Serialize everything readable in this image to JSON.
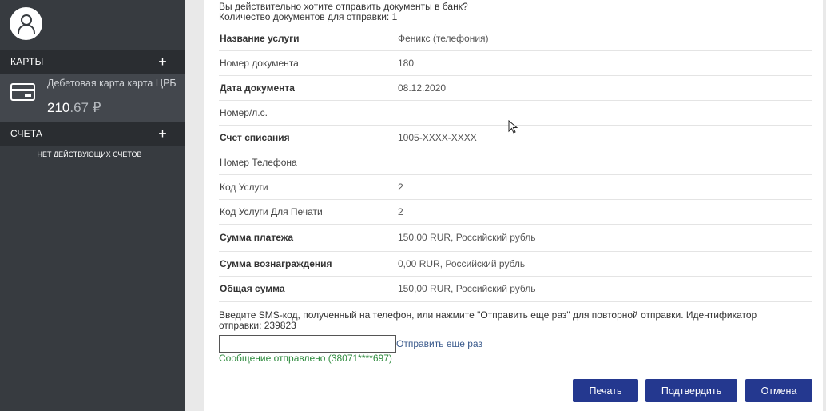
{
  "sidebar": {
    "cards_label": "КАРТЫ",
    "card_name": "Дебетовая карта карта ЦРБ",
    "card_balance_main": "210",
    "card_balance_cents": ".67",
    "card_currency": "₽",
    "accounts_label": "СЧЕТА",
    "no_accounts": "НЕТ ДЕЙСТВУЮЩИХ СЧЕТОВ",
    "plus_symbol": "+"
  },
  "form": {
    "question": "Вы действительно хотите отправить документы в банк?",
    "count_line": "Количество документов для отправки: 1",
    "rows": [
      {
        "label": "Название услуги",
        "value": "Феникс (телефония)",
        "bold": true
      },
      {
        "label": "Номер документа",
        "value": "180",
        "bold": false
      },
      {
        "label": "Дата документа",
        "value": "08.12.2020",
        "bold": true
      },
      {
        "label": "Номер/л.с.",
        "value": "",
        "bold": false
      },
      {
        "label": "Счет списания",
        "value": "1005-XXXX-XXXX",
        "bold": true
      },
      {
        "label": "Номер Телефона",
        "value": "",
        "bold": false
      },
      {
        "label": "Код Услуги",
        "value": "2",
        "bold": false
      },
      {
        "label": "Код Услуги Для Печати",
        "value": "2",
        "bold": false
      },
      {
        "label": "Сумма платежа",
        "value": "150,00 RUR, Российский рубль",
        "bold": true
      },
      {
        "label": "Сумма вознаграждения",
        "value": "0,00 RUR, Российский рубль",
        "bold": true
      },
      {
        "label": "Общая сумма",
        "value": "150,00 RUR, Российский рубль",
        "bold": true
      }
    ],
    "sms_instruction": "Введите SMS-код, полученный на телефон, или нажмите \"Отправить еще раз\" для повторной отправки. Идентификатор отправки: 239823",
    "sms_input_value": "",
    "resend_label": "Отправить еще раз",
    "sent_message": "Сообщение отправлено (38071****697)"
  },
  "buttons": {
    "print": "Печать",
    "confirm": "Подтвердить",
    "cancel": "Отмена"
  },
  "colors": {
    "sidebar_bg": "#373b40",
    "button_bg": "#24388f",
    "success_text": "#2e8b3e"
  }
}
